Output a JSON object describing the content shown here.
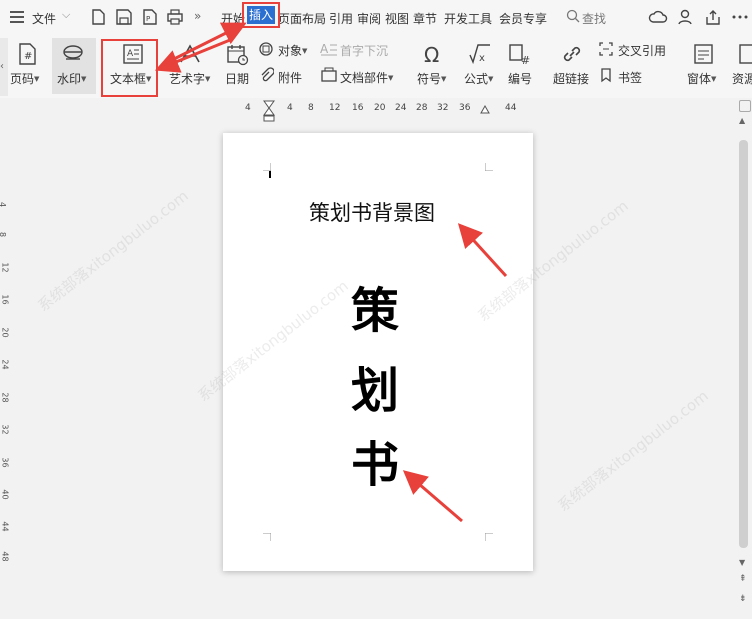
{
  "menubar": {
    "file_label": "文件",
    "tabs": [
      {
        "label": "开始"
      },
      {
        "label": "插入"
      },
      {
        "label": "页面布局"
      },
      {
        "label": "引用"
      },
      {
        "label": "审阅"
      },
      {
        "label": "视图"
      },
      {
        "label": "章节"
      },
      {
        "label": "开发工具"
      },
      {
        "label": "会员专享"
      }
    ],
    "search_label": "查找",
    "more_glyph": "»"
  },
  "ribbon": {
    "page_number": "页码",
    "watermark": "水印",
    "text_box": "文本框",
    "word_art": "艺术字",
    "date": "日期",
    "object": "对象",
    "drop_cap": "首字下沉",
    "attachment": "附件",
    "doc_parts": "文档部件",
    "symbol": "符号",
    "formula": "公式",
    "numbering": "编号",
    "hyperlink": "超链接",
    "cross_ref": "交叉引用",
    "bookmark": "书签",
    "window_form": "窗体",
    "resource": "资源"
  },
  "ruler_top": [
    "4",
    "4",
    "8",
    "12",
    "16",
    "20",
    "24",
    "28",
    "32",
    "36",
    "44"
  ],
  "ruler_left": [
    "4",
    "8",
    "12",
    "16",
    "20",
    "24",
    "28",
    "32",
    "36",
    "40",
    "44",
    "48"
  ],
  "document": {
    "title": "策划书背景图",
    "chars": [
      "策",
      "划",
      "书"
    ]
  },
  "watermark_text": "系统部落xitongbuluo.com",
  "colors": {
    "accent_blue": "#2b6fd1",
    "annotation_red": "#e8403a"
  }
}
